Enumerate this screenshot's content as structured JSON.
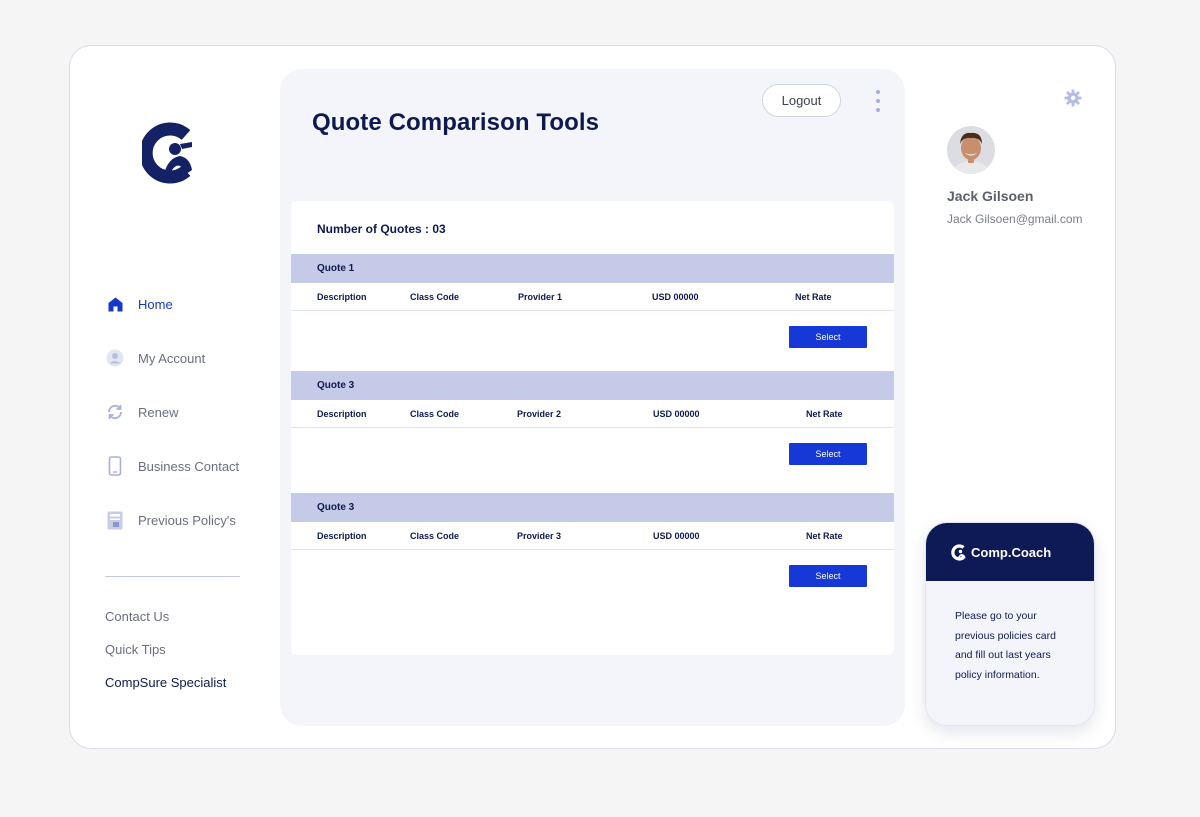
{
  "sidebar": {
    "items": [
      {
        "label": "Home",
        "icon": "home-icon",
        "active": true
      },
      {
        "label": "My Account",
        "icon": "user-icon",
        "active": false
      },
      {
        "label": "Renew",
        "icon": "renew-icon",
        "active": false
      },
      {
        "label": "Business Contact",
        "icon": "phone-icon",
        "active": false
      },
      {
        "label": "Previous Policy's",
        "icon": "document-icon",
        "active": false
      }
    ],
    "links": [
      {
        "label": "Contact Us"
      },
      {
        "label": "Quick Tips"
      },
      {
        "label": "CompSure Specialist"
      }
    ]
  },
  "header": {
    "title": "Quote Comparison Tools",
    "logout_label": "Logout"
  },
  "quotes": {
    "count_label": "Number of Quotes : 03",
    "items": [
      {
        "title": "Quote 1",
        "description": "Description",
        "class_code": "Class Code",
        "provider": "Provider 1",
        "price": "USD 00000",
        "net_rate": "Net Rate",
        "button": "Select"
      },
      {
        "title": "Quote 3",
        "description": "Description",
        "class_code": "Class Code",
        "provider": "Provider 2",
        "price": "USD 00000",
        "net_rate": "Net Rate",
        "button": "Select"
      },
      {
        "title": "Quote 3",
        "description": "Description",
        "class_code": "Class Code",
        "provider": "Provider 3",
        "price": "USD 00000",
        "net_rate": "Net Rate",
        "button": "Select"
      }
    ]
  },
  "user": {
    "name": "Jack Gilsoen",
    "email": "Jack Gilsoen@gmail.com"
  },
  "coach": {
    "brand": "Comp.Coach",
    "message": "Please go to your previous policies card and fill out last years policy information."
  },
  "colors": {
    "accent": "#1638d6",
    "navy": "#0e1a55",
    "quote_header": "#c5cae9",
    "panel": "#f4f5fb"
  }
}
